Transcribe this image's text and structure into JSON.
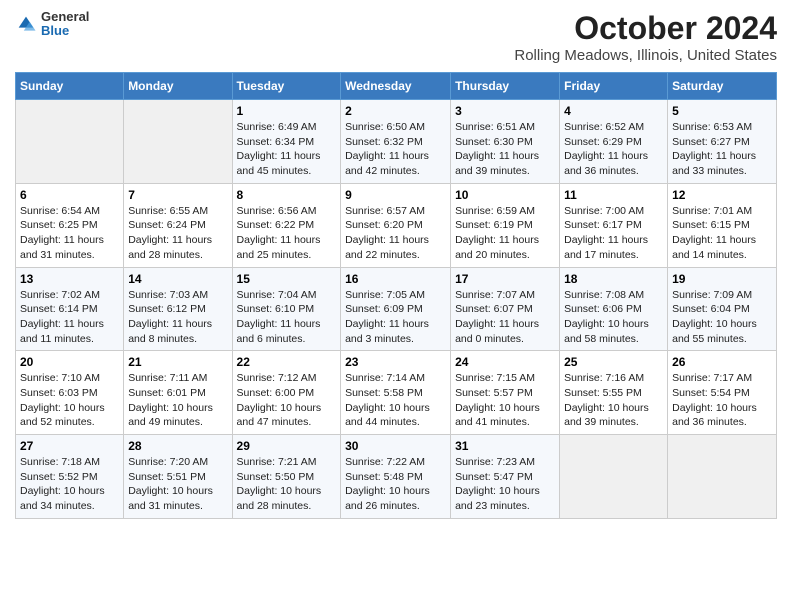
{
  "header": {
    "logo_general": "General",
    "logo_blue": "Blue",
    "title": "October 2024",
    "subtitle": "Rolling Meadows, Illinois, United States"
  },
  "weekdays": [
    "Sunday",
    "Monday",
    "Tuesday",
    "Wednesday",
    "Thursday",
    "Friday",
    "Saturday"
  ],
  "weeks": [
    [
      {
        "day": "",
        "empty": true
      },
      {
        "day": "",
        "empty": true
      },
      {
        "day": "1",
        "sunrise": "6:49 AM",
        "sunset": "6:34 PM",
        "daylight": "11 hours and 45 minutes."
      },
      {
        "day": "2",
        "sunrise": "6:50 AM",
        "sunset": "6:32 PM",
        "daylight": "11 hours and 42 minutes."
      },
      {
        "day": "3",
        "sunrise": "6:51 AM",
        "sunset": "6:30 PM",
        "daylight": "11 hours and 39 minutes."
      },
      {
        "day": "4",
        "sunrise": "6:52 AM",
        "sunset": "6:29 PM",
        "daylight": "11 hours and 36 minutes."
      },
      {
        "day": "5",
        "sunrise": "6:53 AM",
        "sunset": "6:27 PM",
        "daylight": "11 hours and 33 minutes."
      }
    ],
    [
      {
        "day": "6",
        "sunrise": "6:54 AM",
        "sunset": "6:25 PM",
        "daylight": "11 hours and 31 minutes."
      },
      {
        "day": "7",
        "sunrise": "6:55 AM",
        "sunset": "6:24 PM",
        "daylight": "11 hours and 28 minutes."
      },
      {
        "day": "8",
        "sunrise": "6:56 AM",
        "sunset": "6:22 PM",
        "daylight": "11 hours and 25 minutes."
      },
      {
        "day": "9",
        "sunrise": "6:57 AM",
        "sunset": "6:20 PM",
        "daylight": "11 hours and 22 minutes."
      },
      {
        "day": "10",
        "sunrise": "6:59 AM",
        "sunset": "6:19 PM",
        "daylight": "11 hours and 20 minutes."
      },
      {
        "day": "11",
        "sunrise": "7:00 AM",
        "sunset": "6:17 PM",
        "daylight": "11 hours and 17 minutes."
      },
      {
        "day": "12",
        "sunrise": "7:01 AM",
        "sunset": "6:15 PM",
        "daylight": "11 hours and 14 minutes."
      }
    ],
    [
      {
        "day": "13",
        "sunrise": "7:02 AM",
        "sunset": "6:14 PM",
        "daylight": "11 hours and 11 minutes."
      },
      {
        "day": "14",
        "sunrise": "7:03 AM",
        "sunset": "6:12 PM",
        "daylight": "11 hours and 8 minutes."
      },
      {
        "day": "15",
        "sunrise": "7:04 AM",
        "sunset": "6:10 PM",
        "daylight": "11 hours and 6 minutes."
      },
      {
        "day": "16",
        "sunrise": "7:05 AM",
        "sunset": "6:09 PM",
        "daylight": "11 hours and 3 minutes."
      },
      {
        "day": "17",
        "sunrise": "7:07 AM",
        "sunset": "6:07 PM",
        "daylight": "11 hours and 0 minutes."
      },
      {
        "day": "18",
        "sunrise": "7:08 AM",
        "sunset": "6:06 PM",
        "daylight": "10 hours and 58 minutes."
      },
      {
        "day": "19",
        "sunrise": "7:09 AM",
        "sunset": "6:04 PM",
        "daylight": "10 hours and 55 minutes."
      }
    ],
    [
      {
        "day": "20",
        "sunrise": "7:10 AM",
        "sunset": "6:03 PM",
        "daylight": "10 hours and 52 minutes."
      },
      {
        "day": "21",
        "sunrise": "7:11 AM",
        "sunset": "6:01 PM",
        "daylight": "10 hours and 49 minutes."
      },
      {
        "day": "22",
        "sunrise": "7:12 AM",
        "sunset": "6:00 PM",
        "daylight": "10 hours and 47 minutes."
      },
      {
        "day": "23",
        "sunrise": "7:14 AM",
        "sunset": "5:58 PM",
        "daylight": "10 hours and 44 minutes."
      },
      {
        "day": "24",
        "sunrise": "7:15 AM",
        "sunset": "5:57 PM",
        "daylight": "10 hours and 41 minutes."
      },
      {
        "day": "25",
        "sunrise": "7:16 AM",
        "sunset": "5:55 PM",
        "daylight": "10 hours and 39 minutes."
      },
      {
        "day": "26",
        "sunrise": "7:17 AM",
        "sunset": "5:54 PM",
        "daylight": "10 hours and 36 minutes."
      }
    ],
    [
      {
        "day": "27",
        "sunrise": "7:18 AM",
        "sunset": "5:52 PM",
        "daylight": "10 hours and 34 minutes."
      },
      {
        "day": "28",
        "sunrise": "7:20 AM",
        "sunset": "5:51 PM",
        "daylight": "10 hours and 31 minutes."
      },
      {
        "day": "29",
        "sunrise": "7:21 AM",
        "sunset": "5:50 PM",
        "daylight": "10 hours and 28 minutes."
      },
      {
        "day": "30",
        "sunrise": "7:22 AM",
        "sunset": "5:48 PM",
        "daylight": "10 hours and 26 minutes."
      },
      {
        "day": "31",
        "sunrise": "7:23 AM",
        "sunset": "5:47 PM",
        "daylight": "10 hours and 23 minutes."
      },
      {
        "day": "",
        "empty": true
      },
      {
        "day": "",
        "empty": true
      }
    ]
  ],
  "labels": {
    "sunrise_prefix": "Sunrise: ",
    "sunset_prefix": "Sunset: ",
    "daylight_prefix": "Daylight: "
  }
}
